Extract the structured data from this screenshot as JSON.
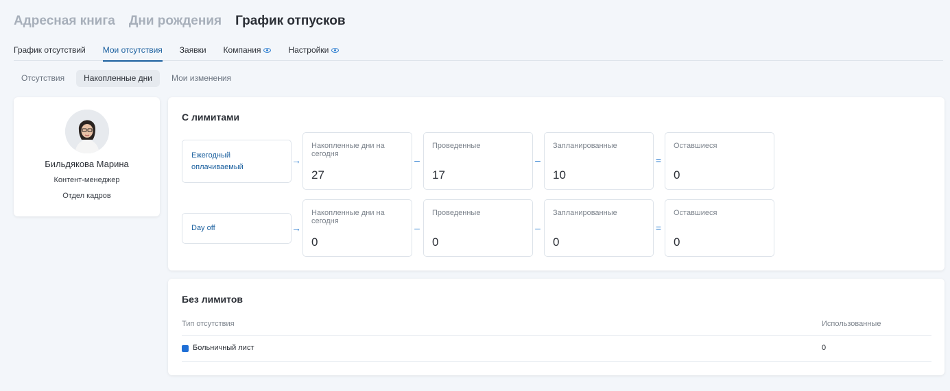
{
  "top_tabs": [
    "Адресная книга",
    "Дни рождения",
    "График отпусков"
  ],
  "sub_tabs": {
    "absence_schedule": "График отсутствий",
    "my_absences": "Мои отсутствия",
    "requests": "Заявки",
    "company": "Компания",
    "settings": "Настройки"
  },
  "pills": [
    "Отсутствия",
    "Накопленные дни",
    "Мои изменения"
  ],
  "profile": {
    "name": "Бильдякова Марина",
    "role": "Контент-менеджер",
    "department": "Отдел кадров"
  },
  "with_limits": {
    "title": "С лимитами",
    "labels": {
      "accrued": "Накопленные дни на сегодня",
      "spent": "Проведенные",
      "planned": "Запланированные",
      "remaining": "Оставшиеся"
    },
    "operators": [
      "→",
      "–",
      "–",
      "="
    ],
    "rows": [
      {
        "type": "Ежегодный оплачиваемый",
        "accrued": "27",
        "spent": "17",
        "planned": "10",
        "remaining": "0"
      },
      {
        "type": "Day off",
        "accrued": "0",
        "spent": "0",
        "planned": "0",
        "remaining": "0"
      }
    ]
  },
  "without_limits": {
    "title": "Без лимитов",
    "columns": {
      "type": "Тип отсутствия",
      "used": "Использованные"
    },
    "rows": [
      {
        "type": "Больничный лист",
        "used": "0",
        "color": "#1f6fd6"
      }
    ]
  },
  "colors": {
    "accent": "#1a5f9e",
    "icon": "#2f7fd0",
    "sick_leave": "#1f6fd6"
  }
}
